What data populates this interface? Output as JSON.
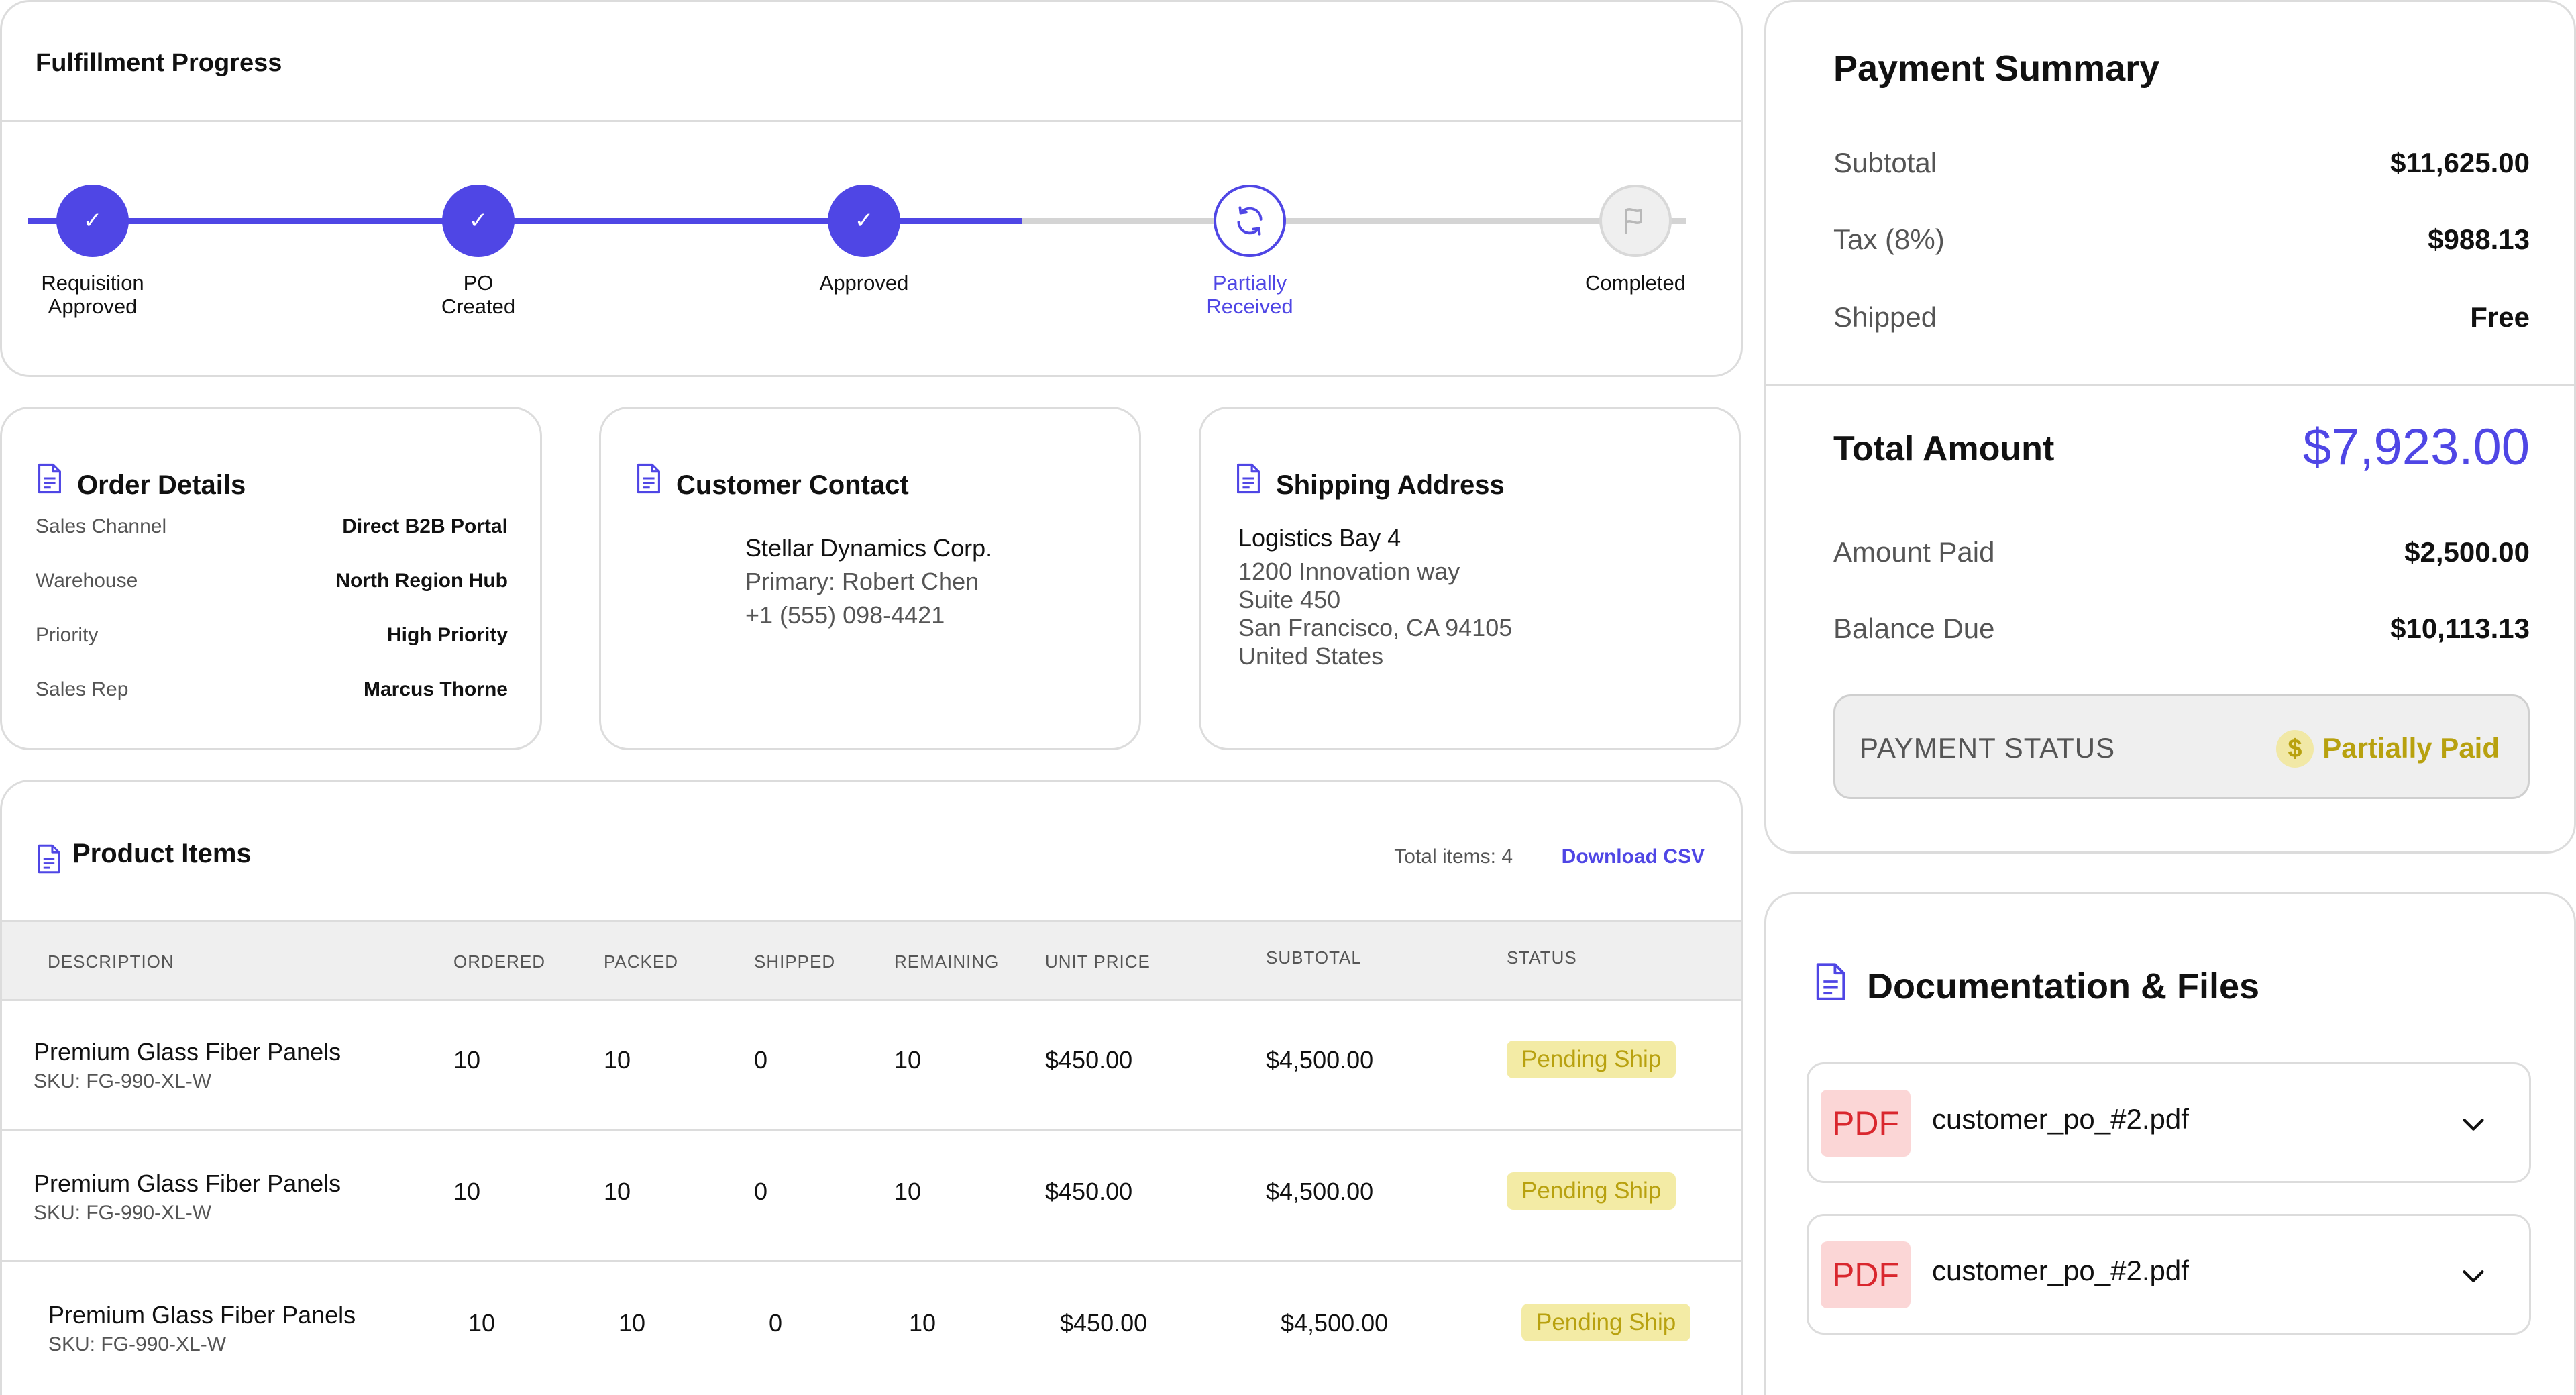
{
  "colors": {
    "accent": "#4f46e5",
    "pending_badge_bg": "#f3eba5",
    "pending_badge_text": "#b8a10f",
    "pdf_bg": "#fbd6d6",
    "pdf_text": "#d9272e"
  },
  "fulfillment": {
    "title": "Fulfillment Progress",
    "progress_fraction": 0.6,
    "steps": [
      {
        "label": "Requisition\nApproved",
        "state": "done",
        "icon": "check-icon"
      },
      {
        "label": "PO\nCreated",
        "state": "done",
        "icon": "check-icon"
      },
      {
        "label": "Approved",
        "state": "done",
        "icon": "check-icon"
      },
      {
        "label": "Partially\nReceived",
        "state": "current",
        "icon": "refresh-icon"
      },
      {
        "label": "Completed",
        "state": "pending",
        "icon": "flag-icon"
      }
    ],
    "check_glyph": "✓"
  },
  "order_details": {
    "title": "Order Details",
    "rows": [
      {
        "label": "Sales Channel",
        "value": "Direct B2B Portal"
      },
      {
        "label": "Warehouse",
        "value": "North Region Hub"
      },
      {
        "label": "Priority",
        "value": "High Priority"
      },
      {
        "label": "Sales Rep",
        "value": "Marcus Thorne"
      }
    ]
  },
  "customer_contact": {
    "title": "Customer Contact",
    "company": "Stellar Dynamics Corp.",
    "primary": "Primary: Robert Chen",
    "phone": "+1 (555) 098-4421"
  },
  "shipping_address": {
    "title": "Shipping Address",
    "name": "Logistics Bay 4",
    "lines": [
      "1200 Innovation way",
      "Suite 450",
      "San Francisco, CA 94105",
      "United States"
    ]
  },
  "product_items": {
    "title": "Product Items",
    "total_items": "Total items: 4",
    "download_label": "Download CSV",
    "columns": [
      "DESCRIPTION",
      "ORDERED",
      "PACKED",
      "SHIPPED",
      "REMAINING",
      "UNIT PRICE",
      "SUBTOTAL",
      "STATUS"
    ],
    "rows": [
      {
        "name": "Premium Glass Fiber Panels",
        "sku": "SKU: FG-990-XL-W",
        "ordered": "10",
        "packed": "10",
        "shipped": "0",
        "remaining": "10",
        "unit_price": "$450.00",
        "subtotal": "$4,500.00",
        "status": "Pending Ship"
      },
      {
        "name": "Premium Glass Fiber Panels",
        "sku": "SKU: FG-990-XL-W",
        "ordered": "10",
        "packed": "10",
        "shipped": "0",
        "remaining": "10",
        "unit_price": "$450.00",
        "subtotal": "$4,500.00",
        "status": "Pending Ship"
      },
      {
        "name": "Premium Glass Fiber Panels",
        "sku": "SKU: FG-990-XL-W",
        "ordered": "10",
        "packed": "10",
        "shipped": "0",
        "remaining": "10",
        "unit_price": "$450.00",
        "subtotal": "$4,500.00",
        "status": "Pending Ship"
      }
    ]
  },
  "payment_summary": {
    "title": "Payment Summary",
    "subtotal_label": "Subtotal",
    "subtotal": "$11,625.00",
    "tax_label": "Tax (8%)",
    "tax": "$988.13",
    "shipped_label": "Shipped",
    "shipped": "Free",
    "total_label": "Total Amount",
    "total": "$7,923.00",
    "paid_label": "Amount Paid",
    "paid": "$2,500.00",
    "balance_label": "Balance Due",
    "balance": "$10,113.13",
    "status_label": "PAYMENT STATUS",
    "status_icon_glyph": "$",
    "status": "Partially Paid"
  },
  "documentation": {
    "title": "Documentation & Files",
    "files": [
      {
        "type": "PDF",
        "name": "customer_po_#2.pdf"
      },
      {
        "type": "PDF",
        "name": "customer_po_#2.pdf"
      }
    ]
  }
}
